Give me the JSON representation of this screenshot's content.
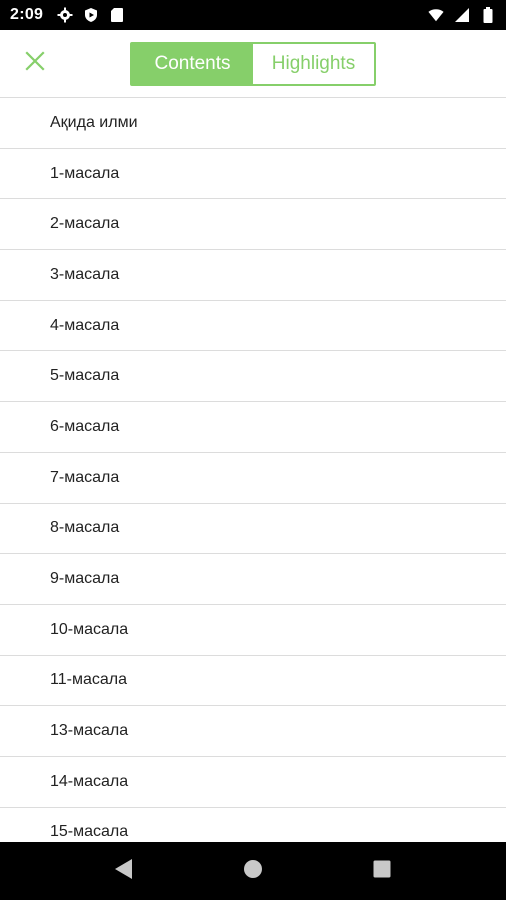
{
  "status_bar": {
    "time": "2:09",
    "left_icons": [
      "settings-icon",
      "play-protect-icon",
      "sd-card-icon"
    ],
    "right_icons": [
      "wifi-icon",
      "signal-icon",
      "battery-icon"
    ]
  },
  "header": {
    "close_icon": "close-icon",
    "tabs": [
      {
        "label": "Contents",
        "active": true
      },
      {
        "label": "Highlights",
        "active": false
      }
    ],
    "accent_color": "#86cf6a"
  },
  "toc": {
    "items": [
      "Ақида илми",
      "1-масала",
      "2-масала",
      "3-масала",
      "4-масала",
      "5-масала",
      "6-масала",
      "7-масала",
      "8-масала",
      "9-масала",
      "10-масала",
      "11-масала",
      "13-масала",
      "14-масала",
      "15-масала"
    ]
  },
  "nav_bar": {
    "buttons": [
      "back-icon",
      "home-icon",
      "recents-icon"
    ]
  }
}
